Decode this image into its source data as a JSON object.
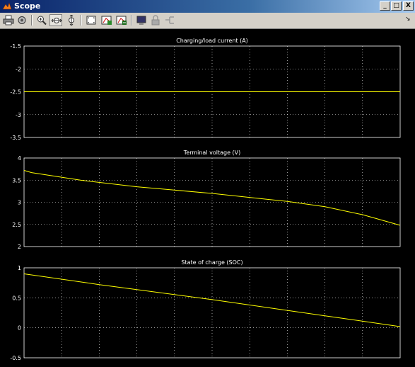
{
  "window": {
    "title": "Scope",
    "buttons": {
      "minimize": "_",
      "maximize": "□",
      "close": "X"
    },
    "menu_arrow": "↘"
  },
  "toolbar": {
    "items": [
      "print",
      "parameters",
      "zoom-in",
      "zoom-x",
      "zoom-y",
      "autoscale",
      "save-axes-settings",
      "restore-axes-settings",
      "floating-scope",
      "lock-axes",
      "signal-selection"
    ]
  },
  "colors": {
    "background": "#000000",
    "trace": "#ffff00",
    "grid": "#ffffff",
    "text": "#ffffff"
  },
  "chart_data": [
    {
      "type": "line",
      "title": "Charging/load current (A)",
      "ylim": [
        -3.5,
        -1.5
      ],
      "yticks": [
        "-1.5",
        "-2",
        "-2.5",
        "-3",
        "-3.5"
      ],
      "xlim": [
        0,
        10
      ],
      "x": [
        0,
        10
      ],
      "y": [
        -2.5,
        -2.5
      ]
    },
    {
      "type": "line",
      "title": "Terminal voltage (V)",
      "ylim": [
        2,
        4
      ],
      "yticks": [
        "4",
        "3.5",
        "3",
        "2.5",
        "2"
      ],
      "xlim": [
        0,
        10
      ],
      "x": [
        0,
        0.2,
        1.5,
        3,
        5,
        7,
        8,
        9,
        10
      ],
      "y": [
        3.72,
        3.67,
        3.5,
        3.35,
        3.2,
        3.02,
        2.9,
        2.72,
        2.48
      ]
    },
    {
      "type": "line",
      "title": "State of charge (SOC)",
      "ylim": [
        -0.5,
        1
      ],
      "yticks": [
        "1",
        "0.5",
        "0",
        "-0.5"
      ],
      "xlim": [
        0,
        10
      ],
      "x": [
        0,
        2,
        5,
        8,
        10
      ],
      "y": [
        0.9,
        0.72,
        0.47,
        0.2,
        0.02
      ]
    }
  ]
}
